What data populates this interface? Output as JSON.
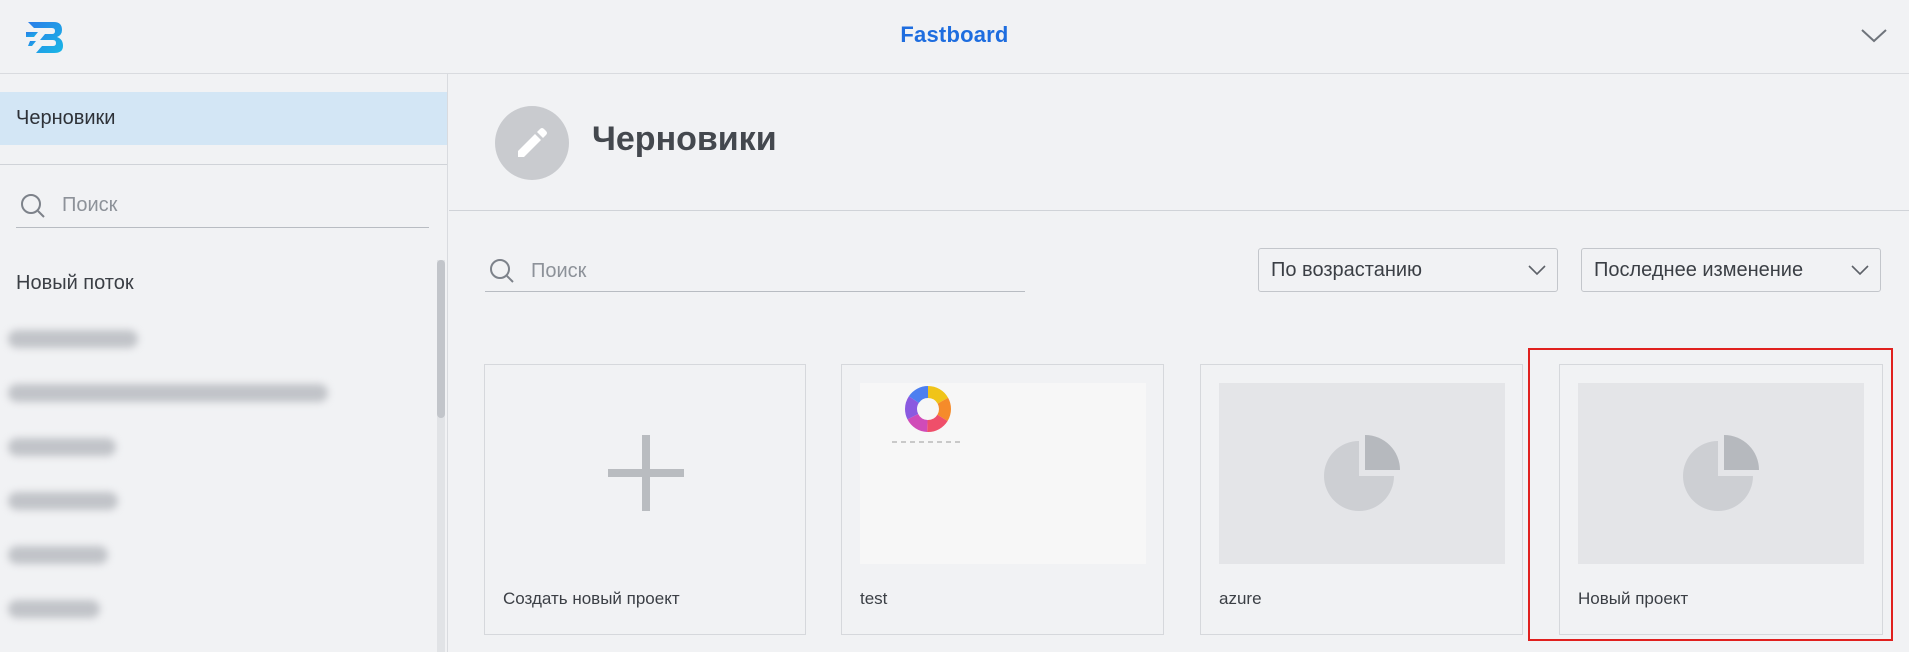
{
  "header": {
    "app_title": "Fastboard",
    "logo_icon": "fastboard-logo-icon",
    "menu_icon": "chevron-down-icon"
  },
  "sidebar": {
    "active_item": "Черновики",
    "search": {
      "placeholder": "Поиск",
      "value": ""
    },
    "flow_title": "Новый поток",
    "blurred_items_count": 6
  },
  "main": {
    "page_title": "Черновики",
    "page_icon": "pencil-icon",
    "search": {
      "placeholder": "Поиск",
      "value": ""
    },
    "sort_order": {
      "selected": "По возрастанию"
    },
    "sort_field": {
      "selected": "Последнее изменение"
    },
    "cards": [
      {
        "label": "Создать новый проект",
        "kind": "create",
        "icon": "plus-icon"
      },
      {
        "label": "test",
        "kind": "preview",
        "icon": "donut-chart-icon"
      },
      {
        "label": "azure",
        "kind": "placeholder",
        "icon": "pie-chart-icon"
      },
      {
        "label": "Новый проект",
        "kind": "placeholder",
        "icon": "pie-chart-icon",
        "highlighted": true
      }
    ]
  },
  "colors": {
    "brand_blue": "#1e6ddf",
    "active_bg": "#d3e6f5",
    "highlight_red": "#e0201e",
    "page_bg": "#f1f2f4"
  }
}
